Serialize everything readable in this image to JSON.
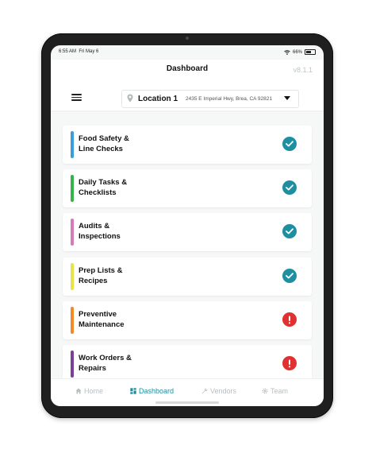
{
  "status_bar": {
    "time": "6:55 AM",
    "date": "Fri May 6",
    "battery": "66%"
  },
  "header": {
    "title": "Dashboard",
    "version": "v8.1.1",
    "location": {
      "name": "Location 1",
      "address": "2435 E Imperial Hwy, Brea, CA 92821"
    }
  },
  "cards": [
    {
      "label": "Food Safety &\nLine Checks",
      "color": "#3a9fd8",
      "status": "complete"
    },
    {
      "label": "Daily Tasks &\nChecklists",
      "color": "#38b24a",
      "status": "complete"
    },
    {
      "label": "Audits &\nInspections",
      "color": "#d47bb8",
      "status": "complete"
    },
    {
      "label": "Prep Lists &\nRecipes",
      "color": "#e8e34a",
      "status": "complete"
    },
    {
      "label": "Preventive\nMaintenance",
      "color": "#f18a2a",
      "status": "alert"
    },
    {
      "label": "Work Orders &\nRepairs",
      "color": "#7a3f98",
      "status": "alert"
    }
  ],
  "tabs": [
    {
      "label": "Home",
      "icon": "home-icon",
      "active": false
    },
    {
      "label": "Dashboard",
      "icon": "grid-icon",
      "active": true
    },
    {
      "label": "Vendors",
      "icon": "wrench-icon",
      "active": false
    },
    {
      "label": "Team",
      "icon": "gear-icon",
      "active": false
    }
  ],
  "colors": {
    "complete": "#1d8fa0",
    "alert": "#e0302f",
    "tab_active": "#1d8fa0",
    "tab_inactive": "#b9bec1"
  }
}
